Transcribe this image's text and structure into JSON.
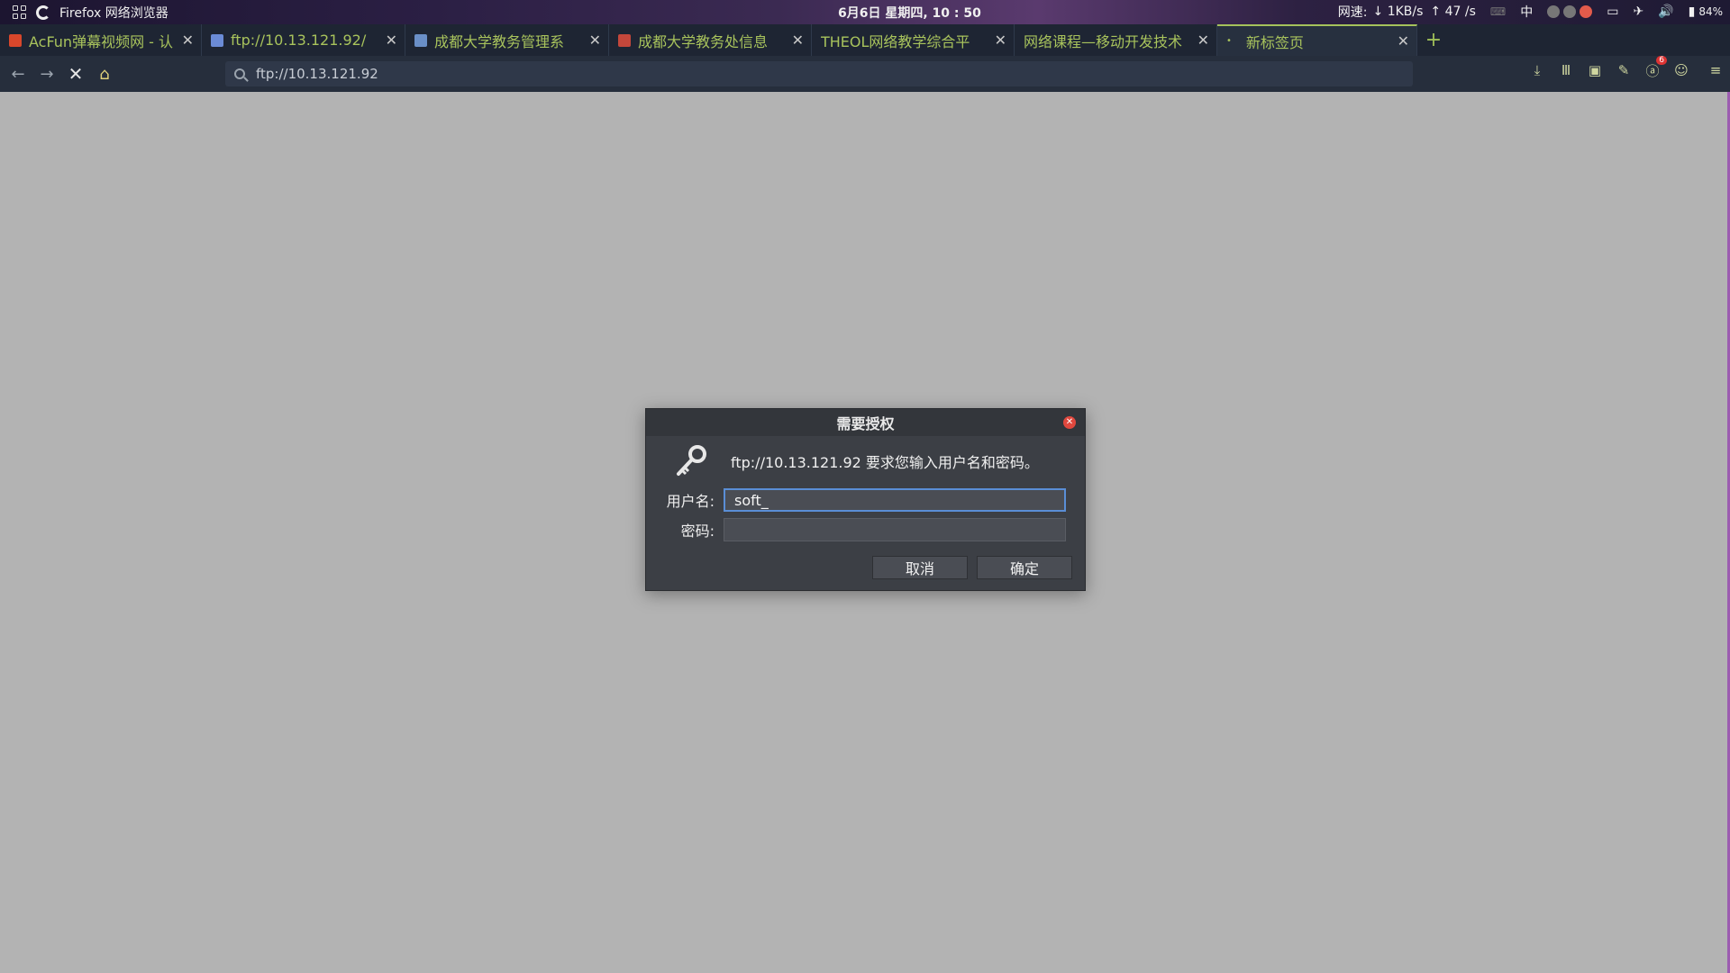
{
  "system_panel": {
    "app_name": "Firefox 网络浏览器",
    "datetime": "6月6日 星期四, 10 : 50",
    "network_label": "网速:",
    "download": "↓ 1KB/s",
    "upload": "↑ 47 /s",
    "input_method": "中",
    "battery": "84%"
  },
  "tabs": [
    {
      "label": "AcFun弹幕视频网 - 认",
      "favicon_color": "#d9472b"
    },
    {
      "label": "ftp://10.13.121.92/",
      "favicon_color": "#6b8bd6"
    },
    {
      "label": "成都大学教务管理系",
      "favicon_color": "#6a8fc7"
    },
    {
      "label": "成都大学教务处信息",
      "favicon_color": "#c4473b"
    },
    {
      "label": "THEOL网络教学综合平",
      "favicon_color": ""
    },
    {
      "label": "网络课程—移动开发技术",
      "favicon_color": ""
    },
    {
      "label": "新标签页",
      "favicon_color": "",
      "active": true
    }
  ],
  "navbar": {
    "url": "ftp://10.13.121.92",
    "addon_badge": "6"
  },
  "dialog": {
    "title": "需要授权",
    "message": "ftp://10.13.121.92 要求您输入用户名和密码。",
    "username_label": "用户名:",
    "username_value": "soft_",
    "password_label": "密码:",
    "password_value": "",
    "cancel_label": "取消",
    "ok_label": "确定"
  },
  "colors": {
    "tab_text": "#a8c35c",
    "focus_border": "#5a8ed6",
    "content_bg": "#b3b3b3"
  }
}
